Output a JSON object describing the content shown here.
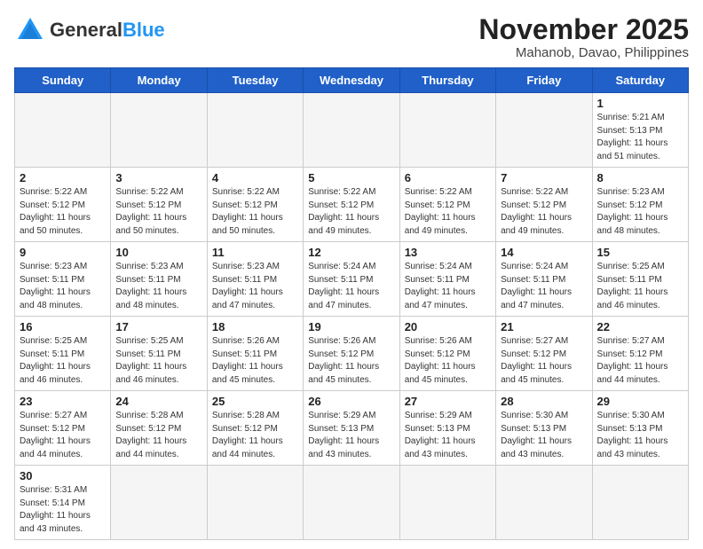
{
  "header": {
    "logo_general": "General",
    "logo_blue": "Blue",
    "month_title": "November 2025",
    "subtitle": "Mahanob, Davao, Philippines"
  },
  "days_of_week": [
    "Sunday",
    "Monday",
    "Tuesday",
    "Wednesday",
    "Thursday",
    "Friday",
    "Saturday"
  ],
  "weeks": [
    [
      {
        "day": "",
        "info": ""
      },
      {
        "day": "",
        "info": ""
      },
      {
        "day": "",
        "info": ""
      },
      {
        "day": "",
        "info": ""
      },
      {
        "day": "",
        "info": ""
      },
      {
        "day": "",
        "info": ""
      },
      {
        "day": "1",
        "info": "Sunrise: 5:21 AM\nSunset: 5:13 PM\nDaylight: 11 hours\nand 51 minutes."
      }
    ],
    [
      {
        "day": "2",
        "info": "Sunrise: 5:22 AM\nSunset: 5:12 PM\nDaylight: 11 hours\nand 50 minutes."
      },
      {
        "day": "3",
        "info": "Sunrise: 5:22 AM\nSunset: 5:12 PM\nDaylight: 11 hours\nand 50 minutes."
      },
      {
        "day": "4",
        "info": "Sunrise: 5:22 AM\nSunset: 5:12 PM\nDaylight: 11 hours\nand 50 minutes."
      },
      {
        "day": "5",
        "info": "Sunrise: 5:22 AM\nSunset: 5:12 PM\nDaylight: 11 hours\nand 49 minutes."
      },
      {
        "day": "6",
        "info": "Sunrise: 5:22 AM\nSunset: 5:12 PM\nDaylight: 11 hours\nand 49 minutes."
      },
      {
        "day": "7",
        "info": "Sunrise: 5:22 AM\nSunset: 5:12 PM\nDaylight: 11 hours\nand 49 minutes."
      },
      {
        "day": "8",
        "info": "Sunrise: 5:23 AM\nSunset: 5:12 PM\nDaylight: 11 hours\nand 48 minutes."
      }
    ],
    [
      {
        "day": "9",
        "info": "Sunrise: 5:23 AM\nSunset: 5:11 PM\nDaylight: 11 hours\nand 48 minutes."
      },
      {
        "day": "10",
        "info": "Sunrise: 5:23 AM\nSunset: 5:11 PM\nDaylight: 11 hours\nand 48 minutes."
      },
      {
        "day": "11",
        "info": "Sunrise: 5:23 AM\nSunset: 5:11 PM\nDaylight: 11 hours\nand 47 minutes."
      },
      {
        "day": "12",
        "info": "Sunrise: 5:24 AM\nSunset: 5:11 PM\nDaylight: 11 hours\nand 47 minutes."
      },
      {
        "day": "13",
        "info": "Sunrise: 5:24 AM\nSunset: 5:11 PM\nDaylight: 11 hours\nand 47 minutes."
      },
      {
        "day": "14",
        "info": "Sunrise: 5:24 AM\nSunset: 5:11 PM\nDaylight: 11 hours\nand 47 minutes."
      },
      {
        "day": "15",
        "info": "Sunrise: 5:25 AM\nSunset: 5:11 PM\nDaylight: 11 hours\nand 46 minutes."
      }
    ],
    [
      {
        "day": "16",
        "info": "Sunrise: 5:25 AM\nSunset: 5:11 PM\nDaylight: 11 hours\nand 46 minutes."
      },
      {
        "day": "17",
        "info": "Sunrise: 5:25 AM\nSunset: 5:11 PM\nDaylight: 11 hours\nand 46 minutes."
      },
      {
        "day": "18",
        "info": "Sunrise: 5:26 AM\nSunset: 5:11 PM\nDaylight: 11 hours\nand 45 minutes."
      },
      {
        "day": "19",
        "info": "Sunrise: 5:26 AM\nSunset: 5:12 PM\nDaylight: 11 hours\nand 45 minutes."
      },
      {
        "day": "20",
        "info": "Sunrise: 5:26 AM\nSunset: 5:12 PM\nDaylight: 11 hours\nand 45 minutes."
      },
      {
        "day": "21",
        "info": "Sunrise: 5:27 AM\nSunset: 5:12 PM\nDaylight: 11 hours\nand 45 minutes."
      },
      {
        "day": "22",
        "info": "Sunrise: 5:27 AM\nSunset: 5:12 PM\nDaylight: 11 hours\nand 44 minutes."
      }
    ],
    [
      {
        "day": "23",
        "info": "Sunrise: 5:27 AM\nSunset: 5:12 PM\nDaylight: 11 hours\nand 44 minutes."
      },
      {
        "day": "24",
        "info": "Sunrise: 5:28 AM\nSunset: 5:12 PM\nDaylight: 11 hours\nand 44 minutes."
      },
      {
        "day": "25",
        "info": "Sunrise: 5:28 AM\nSunset: 5:12 PM\nDaylight: 11 hours\nand 44 minutes."
      },
      {
        "day": "26",
        "info": "Sunrise: 5:29 AM\nSunset: 5:13 PM\nDaylight: 11 hours\nand 43 minutes."
      },
      {
        "day": "27",
        "info": "Sunrise: 5:29 AM\nSunset: 5:13 PM\nDaylight: 11 hours\nand 43 minutes."
      },
      {
        "day": "28",
        "info": "Sunrise: 5:30 AM\nSunset: 5:13 PM\nDaylight: 11 hours\nand 43 minutes."
      },
      {
        "day": "29",
        "info": "Sunrise: 5:30 AM\nSunset: 5:13 PM\nDaylight: 11 hours\nand 43 minutes."
      }
    ],
    [
      {
        "day": "30",
        "info": "Sunrise: 5:31 AM\nSunset: 5:14 PM\nDaylight: 11 hours\nand 43 minutes."
      },
      {
        "day": "",
        "info": ""
      },
      {
        "day": "",
        "info": ""
      },
      {
        "day": "",
        "info": ""
      },
      {
        "day": "",
        "info": ""
      },
      {
        "day": "",
        "info": ""
      },
      {
        "day": "",
        "info": ""
      }
    ]
  ]
}
